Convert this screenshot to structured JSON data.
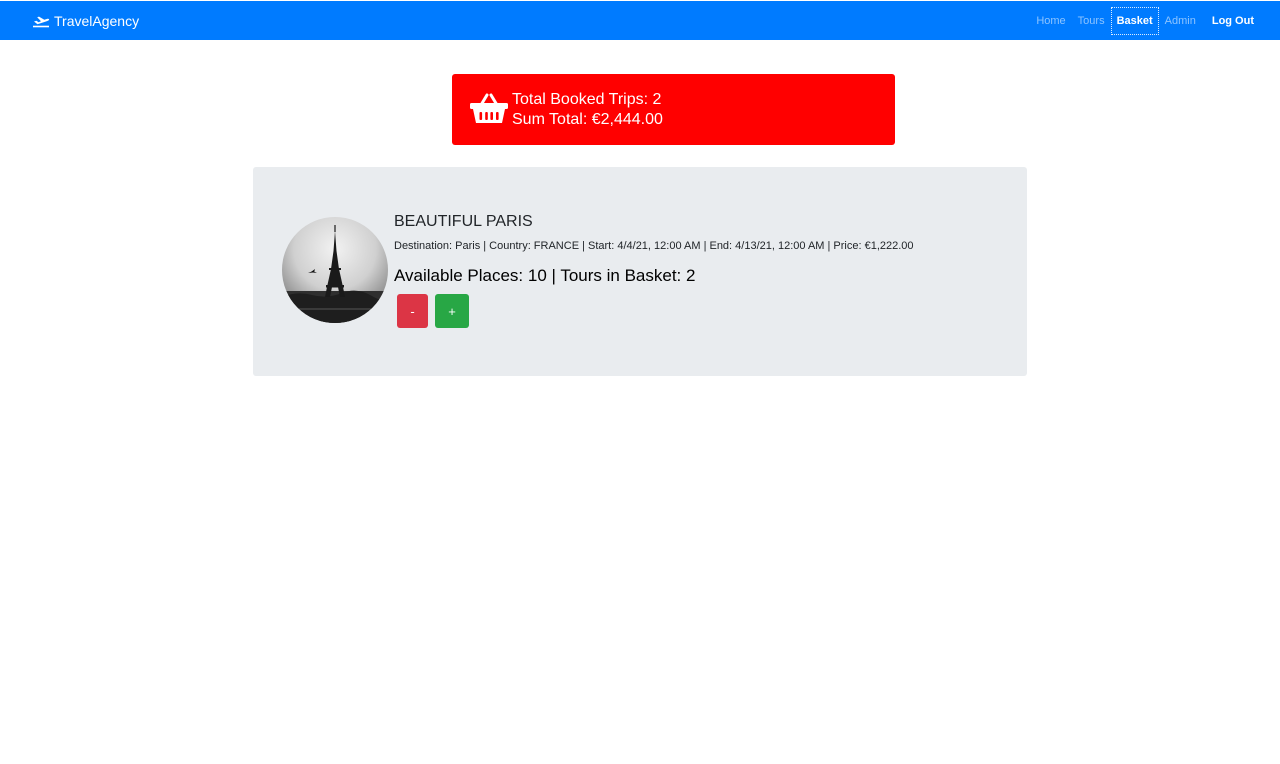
{
  "navbar": {
    "brand": "TravelAgency",
    "brand_icon": "plane-departure-icon",
    "links": [
      {
        "label": "Home"
      },
      {
        "label": "Tours"
      },
      {
        "label": "Basket"
      },
      {
        "label": "Admin"
      },
      {
        "label": "Log Out"
      }
    ],
    "active_link": "Basket",
    "color": "#007bff"
  },
  "summary": {
    "icon": "basket-icon",
    "booked_trips": "Total Booked Trips: 2",
    "sum_total": "Sum Total: €2,444.00",
    "color": "#ff0000"
  },
  "tour": {
    "title": "BEAUTIFUL PARIS",
    "details": "Destination: Paris | Country: FRANCE | Start: 4/4/21, 12:00 AM | End: 4/13/21, 12:00 AM | Price: €1,222.00",
    "places": "Available Places: 10 | Tours in Basket: 2",
    "image": "eiffel-tower-photo",
    "minus_label": "-",
    "plus_label": "+"
  },
  "colors": {
    "card_bg": "#e9ecef",
    "minus_button": "#dc3545",
    "plus_button": "#28a745"
  }
}
